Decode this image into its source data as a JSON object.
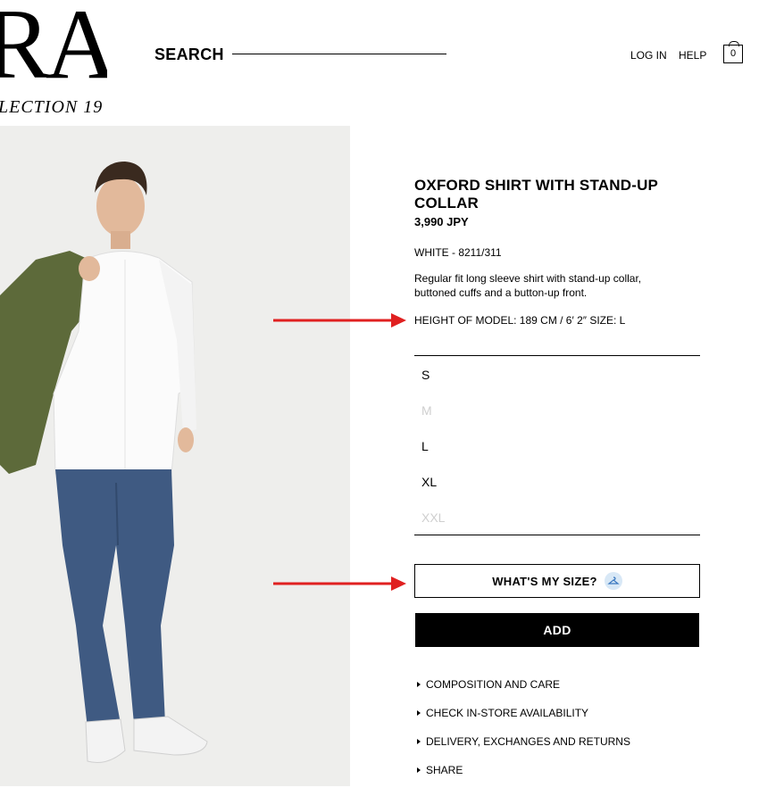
{
  "header": {
    "logo_main": "RA",
    "logo_sub": "LECTION 19",
    "search_label": "SEARCH",
    "login_label": "LOG IN",
    "help_label": "HELP",
    "cart_count": "0"
  },
  "product": {
    "title": "OXFORD SHIRT WITH STAND-UP COLLAR",
    "price": "3,990 JPY",
    "color_ref": "WHITE - 8211/311",
    "description": "Regular fit long sleeve shirt with stand-up collar, buttoned cuffs and a button-up front.",
    "model_info": "HEIGHT OF MODEL: 189 CM / 6′ 2″ SIZE: L"
  },
  "sizes": [
    {
      "label": "S",
      "available": true
    },
    {
      "label": "M",
      "available": false
    },
    {
      "label": "L",
      "available": true
    },
    {
      "label": "XL",
      "available": true
    },
    {
      "label": "XXL",
      "available": false
    }
  ],
  "buttons": {
    "whats_my_size": "WHAT'S MY SIZE?",
    "add": "ADD"
  },
  "accordion": [
    "COMPOSITION AND CARE",
    "CHECK IN-STORE AVAILABILITY",
    "DELIVERY, EXCHANGES AND RETURNS",
    "SHARE"
  ],
  "colors": {
    "arrow": "#e02020",
    "image_bg": "#eeeeec",
    "disabled_size": "#cfcfcf"
  }
}
